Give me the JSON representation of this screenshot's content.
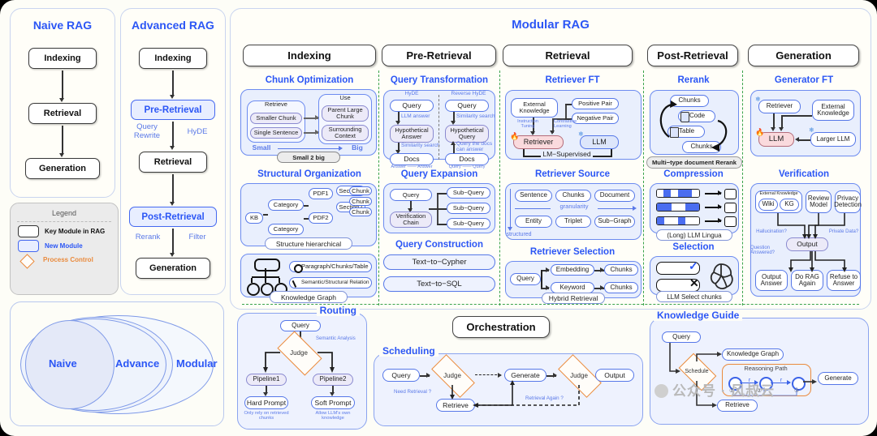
{
  "columns_left": {
    "naive": {
      "title": "Naive RAG",
      "nodes": [
        "Indexing",
        "Retrieval",
        "Generation"
      ]
    },
    "advanced": {
      "title": "Advanced RAG",
      "nodes": [
        "Indexing",
        "Pre-Retrieval",
        "Retrieval",
        "Post-Retrieval",
        "Generation"
      ],
      "edge_labels": [
        "Query Rewrite",
        "HyDE",
        "Rerank",
        "Filter"
      ]
    }
  },
  "legend": {
    "title": "Legend",
    "items": [
      {
        "label": "Key Module in RAG",
        "color": "#ffffff",
        "border": "#333333",
        "text_color": "#111111"
      },
      {
        "label": "New Module",
        "color": "#e8eeff",
        "border": "#4468f0",
        "text_color": "#2b56f5"
      },
      {
        "label": "Process Control",
        "color": "#fffdf9",
        "border": "#ea8a3c",
        "text_color": "#ea8a3c"
      }
    ]
  },
  "venn": {
    "labels": [
      "Naive",
      "Advance",
      "Modular"
    ]
  },
  "modular": {
    "title": "Modular RAG",
    "headers": [
      "Indexing",
      "Pre-Retrieval",
      "Retrieval",
      "Post-Retrieval",
      "Generation"
    ]
  },
  "indexing": {
    "chunk_optimization": {
      "title": "Chunk Optimization",
      "retrieve_label": "Retrieve",
      "use_label": "Use",
      "retrieve_items": [
        "Smaller Chunk",
        "Single Sentence"
      ],
      "use_items": [
        "Parent Large Chunk",
        "Surrounding Context"
      ],
      "small_label": "Small",
      "big_label": "Big",
      "caption": "Small 2 big"
    },
    "structural_organization": {
      "title": "Structural Organization",
      "kb": "KB",
      "categories": [
        "Category",
        "Category"
      ],
      "pdfs": [
        "PDF1",
        "PDF2"
      ],
      "sections": [
        "Section1",
        "Section2"
      ],
      "chunks": [
        "Chunk",
        "Chunk",
        "Chunk"
      ],
      "caption": "Structure hierarchical",
      "kg_items": [
        "Paragraph/Chunks/Table",
        "Semantic/Structural Relation"
      ],
      "kg_caption": "Knowledge Graph"
    }
  },
  "pre_retrieval": {
    "query_transformation": {
      "title": "Query Transformation",
      "left_header": "HyDE",
      "right_header": "Reverse HyDE",
      "left_nodes": [
        "Query",
        "Hypothetical Answer",
        "Docs"
      ],
      "left_edges": [
        "LLM answer",
        "Similarity search"
      ],
      "left_footer": "Answer —— Answer",
      "right_nodes": [
        "Query",
        "Hypothetical Query",
        "Docs"
      ],
      "right_edges": [
        "Similarity search",
        "Query the docs can answer"
      ],
      "right_footer": "Query —— Query"
    },
    "query_expansion": {
      "title": "Query Expansion",
      "query": "Query",
      "verification": "Verification Chain",
      "subqueries": [
        "Sub−Query",
        "Sub−Query",
        "Sub−Query"
      ]
    },
    "query_construction": {
      "title": "Query Construction",
      "items": [
        "Text−to−Cypher",
        "Text−to−SQL"
      ]
    }
  },
  "retrieval": {
    "retriever_ft": {
      "title": "Retriever FT",
      "external_knowledge": "External Knowledge",
      "positive_pair": "Positive Pair",
      "negative_pair": "Negative Pair",
      "retriever": "Retriever",
      "llm": "LLM",
      "edge_labels": [
        "Instruction Tuning",
        "Contrastive Learning"
      ],
      "caption": "LM−Supervised"
    },
    "retriever_source": {
      "title": "Retriever Source",
      "row1": [
        "Sentence",
        "Chunks",
        "Document"
      ],
      "row2": [
        "Entity",
        "Triplet",
        "Sub−Graph"
      ],
      "axis_h": "granularity",
      "axis_v": "structured"
    },
    "retriever_selection": {
      "title": "Retriever Selection",
      "query": "Query",
      "branches": [
        "Embedding",
        "Keyword"
      ],
      "results": [
        "Chunks",
        "Chunks"
      ],
      "caption": "Hybrid Retrieval"
    }
  },
  "post_retrieval": {
    "rerank": {
      "title": "Rerank",
      "items": [
        "Chunks",
        "Code",
        "Table",
        "Chunks"
      ],
      "caption": "Multi−type document Rerank"
    },
    "compression": {
      "title": "Compression",
      "caption": "(Long) LLM Lingua",
      "rows": [
        [
          0,
          1,
          0,
          1,
          1,
          0
        ],
        [
          1,
          1,
          0,
          0,
          1,
          1
        ],
        [
          1,
          0,
          0,
          1,
          0,
          0
        ]
      ]
    },
    "selection": {
      "title": "Selection",
      "caption": "LLM Select chunks",
      "marks": [
        "check",
        "cross"
      ]
    }
  },
  "generation": {
    "generator_ft": {
      "title": "Generator FT",
      "retriever": "Retriever",
      "external_knowledge": "External Knowledge",
      "llm": "LLM",
      "larger_llm": "Larger LLM"
    },
    "verification": {
      "title": "Verification",
      "external_knowledge_label": "External Knowledge",
      "sources": [
        "Wiki",
        "KG"
      ],
      "review_model": "Review Model",
      "privacy_detection": "Privacy Detection",
      "output": "Output",
      "edge_labels": [
        "Hallucination?",
        "Private Data?",
        "Question Answered?"
      ],
      "results": [
        "Output Answer",
        "Do RAG Again",
        "Refuse to Answer"
      ]
    }
  },
  "routing": {
    "title": "Routing",
    "query": "Query",
    "judge": "Judge",
    "edge_label": "Semantic Analysis",
    "pipelines": [
      "Pipeline1",
      "Pipeline2"
    ],
    "prompts": [
      "Hard Prompt",
      "Soft Prompt"
    ],
    "notes": [
      "Only rely on retrieved chunks",
      "Allow LLM's own knowledge"
    ]
  },
  "orchestration": {
    "title": "Orchestration",
    "scheduling": {
      "title": "Scheduling",
      "nodes": [
        "Query",
        "Judge",
        "Generate",
        "Judge",
        "Output",
        "Retrieve"
      ],
      "edge_labels": [
        "Need Retrieval ?",
        "Retrieval Again ?"
      ]
    }
  },
  "knowledge_guide": {
    "title": "Knowledge Guide",
    "query": "Query",
    "knowledge_graph": "Knowledge Graph",
    "schedule": "Schedule",
    "reasoning_path": "Reasoning Path",
    "relations": [
      "r",
      "r"
    ],
    "generate": "Generate",
    "retrieve": "Retrieve",
    "step_marks": [
      "①",
      "②",
      "③"
    ]
  },
  "watermark": {
    "text": "公众号 · 风叔云"
  }
}
